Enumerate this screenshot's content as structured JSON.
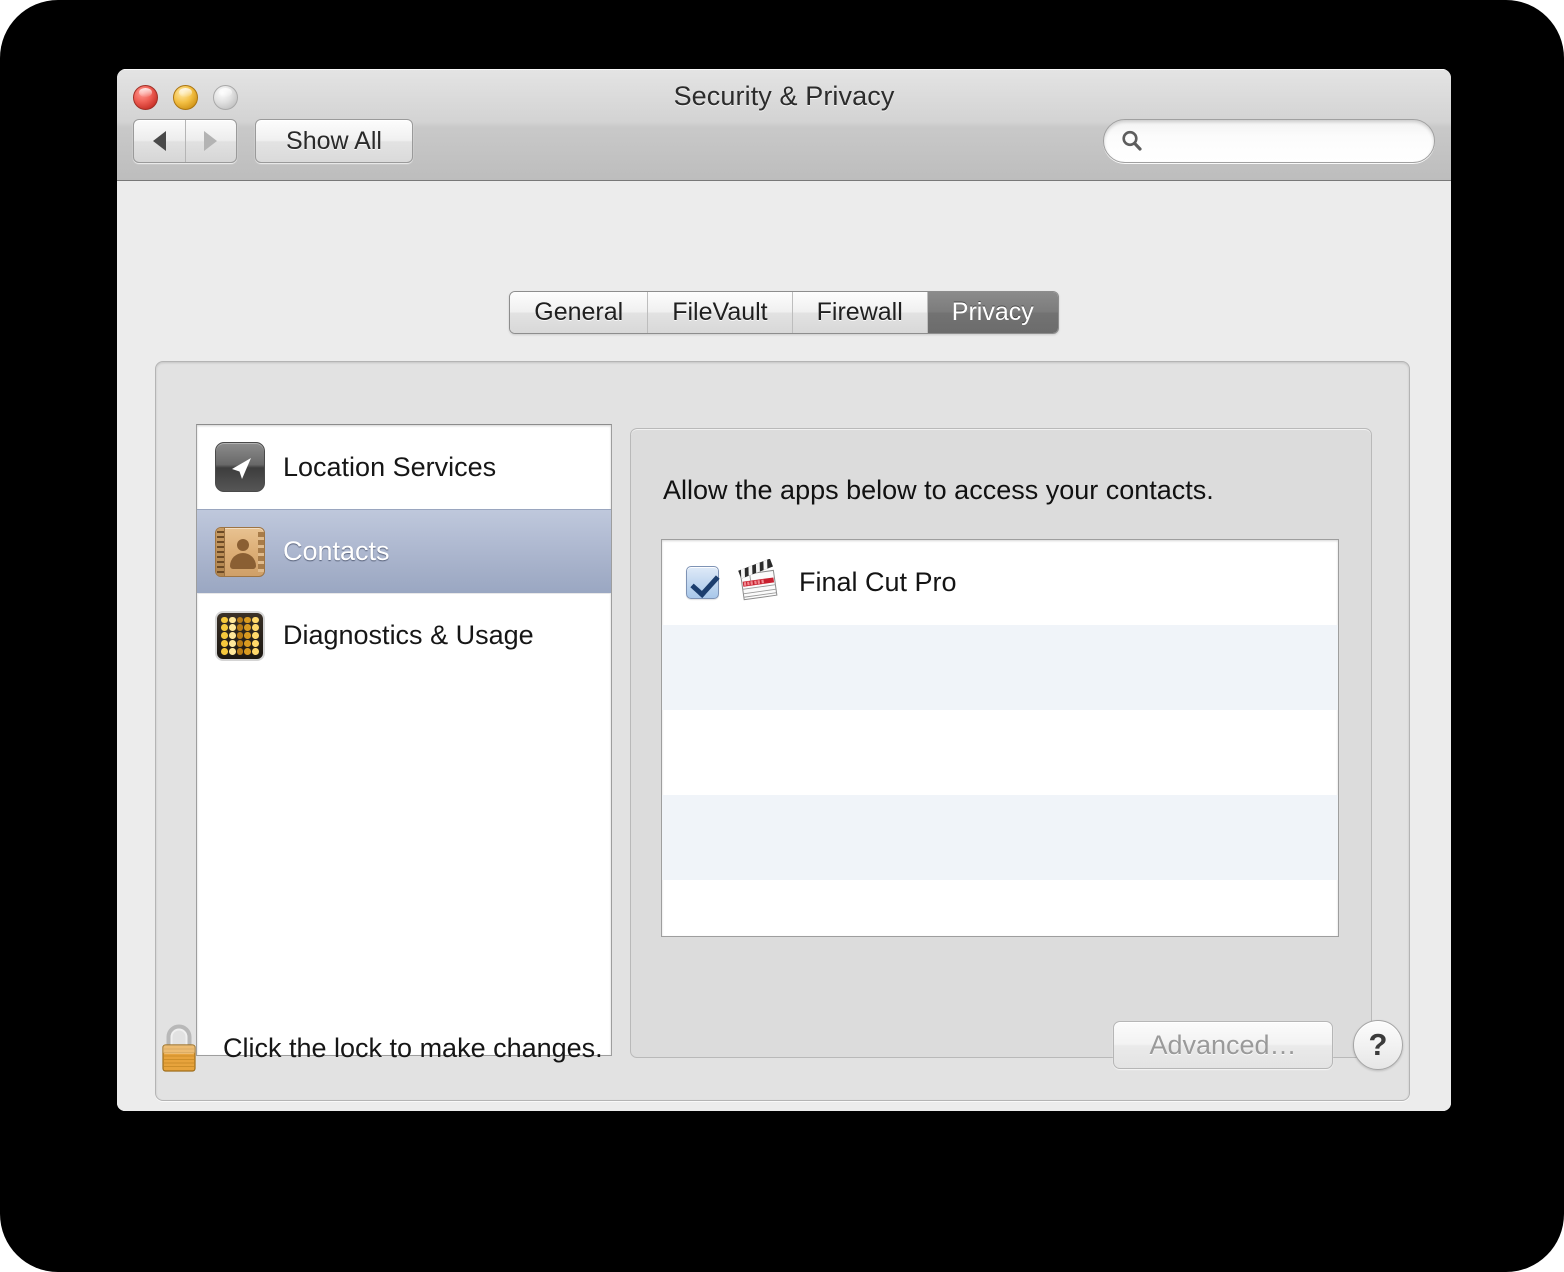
{
  "window": {
    "title": "Security & Privacy",
    "traffic_lights": {
      "close": "close-button",
      "minimize": "minimize-button",
      "zoom": "zoom-button"
    }
  },
  "toolbar": {
    "back_label": "back-arrow",
    "forward_label": "forward-arrow",
    "show_all_label": "Show All",
    "search": {
      "value": "",
      "placeholder": "",
      "icon": "search-icon"
    }
  },
  "tabs": [
    {
      "label": "General",
      "selected": false
    },
    {
      "label": "FileVault",
      "selected": false
    },
    {
      "label": "Firewall",
      "selected": false
    },
    {
      "label": "Privacy",
      "selected": true
    }
  ],
  "sidebar": {
    "items": [
      {
        "label": "Location Services",
        "icon": "location-arrow-icon",
        "selected": false
      },
      {
        "label": "Contacts",
        "icon": "address-book-icon",
        "selected": true
      },
      {
        "label": "Diagnostics & Usage",
        "icon": "diagnostics-grid-icon",
        "selected": false
      }
    ]
  },
  "detail": {
    "title": "Allow the apps below to access your contacts.",
    "apps": [
      {
        "name": "Final Cut Pro",
        "checked": true,
        "icon": "clapperboard-icon"
      }
    ],
    "empty_rows": 4
  },
  "footer": {
    "lock_icon": "padlock-closed-icon",
    "lock_text": "Click the lock to make changes.",
    "advanced_label": "Advanced…",
    "advanced_disabled": true,
    "help_label": "?"
  },
  "colors": {
    "selection_blue": "#a5b0c9",
    "stripe_row": "#f0f4f9",
    "tab_selected": "#727272",
    "checkbox_blue": "#c3d8f0"
  }
}
